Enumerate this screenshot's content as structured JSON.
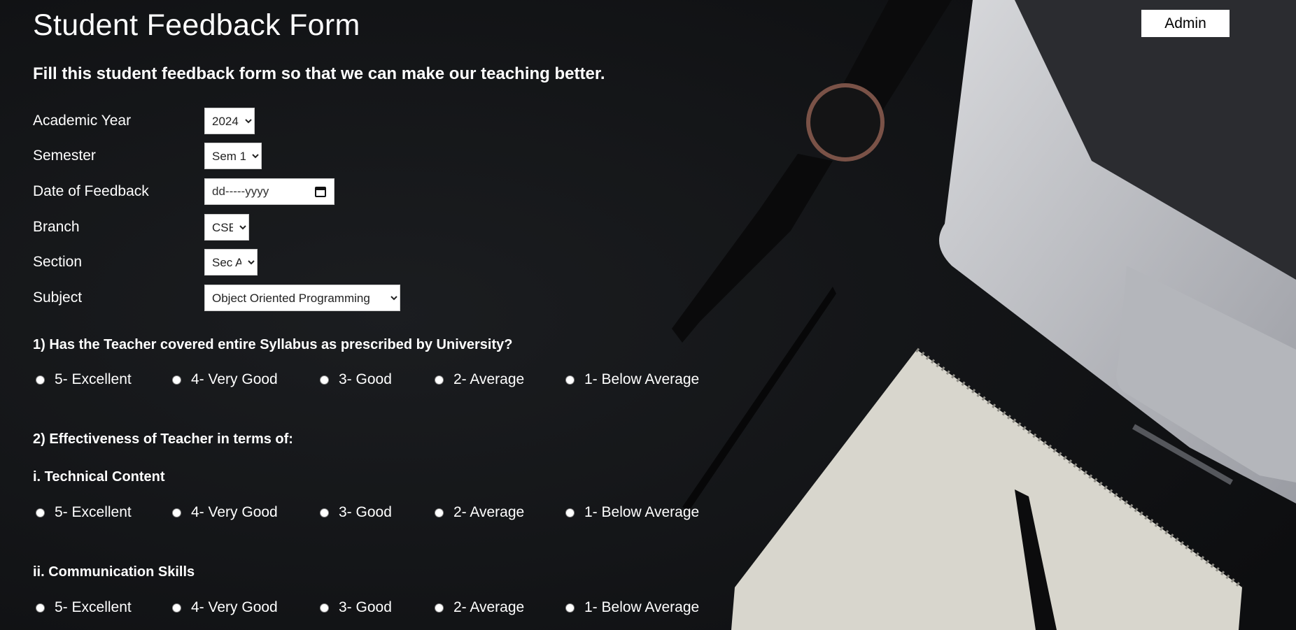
{
  "page": {
    "title": "Student Feedback Form",
    "subtitle": "Fill this student feedback form so that we can make our teaching better.",
    "admin_label": "Admin"
  },
  "fields": {
    "academic_year": {
      "label": "Academic Year",
      "value": "2024"
    },
    "semester": {
      "label": "Semester",
      "value": "Sem 1"
    },
    "date": {
      "label": "Date of Feedback",
      "placeholder": "dd-----yyyy"
    },
    "branch": {
      "label": "Branch",
      "value": "CSE"
    },
    "section": {
      "label": "Section",
      "value": "Sec A"
    },
    "subject": {
      "label": "Subject",
      "value": "Object Oriented Programming"
    }
  },
  "questions": {
    "q1": "1) Has the Teacher covered entire Syllabus as prescribed by University?",
    "q2": "2) Effectiveness of Teacher in terms of:",
    "q2_i": "i. Technical Content",
    "q2_ii": "ii. Communication Skills"
  },
  "ratings": [
    "5- Excellent",
    "4- Very Good",
    "3- Good",
    "2- Average",
    "1- Below Average"
  ],
  "icons": {
    "date": "calendar-icon",
    "dropdown": "chevron-down-icon"
  },
  "colors": {
    "background": "#131517",
    "text": "#ffffff",
    "button": "#ffffff"
  }
}
